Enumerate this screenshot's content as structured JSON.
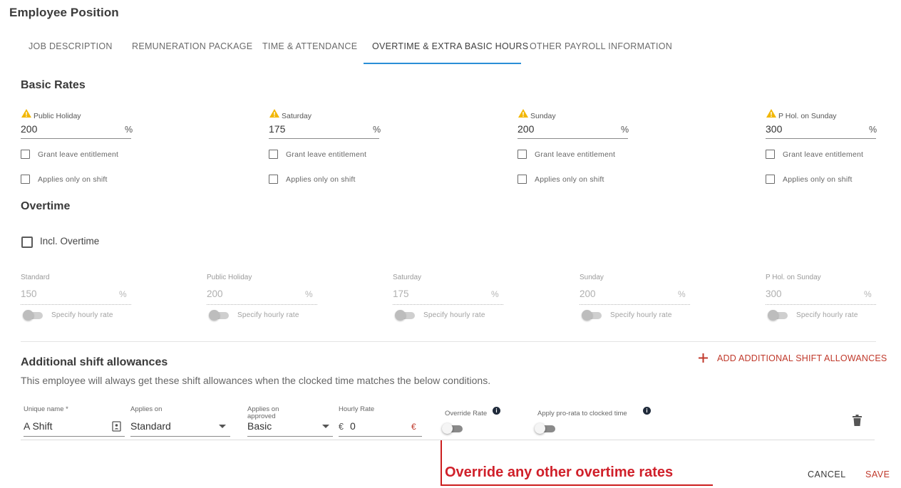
{
  "header": {
    "title": "Employee Position"
  },
  "tabs": [
    {
      "label": "JOB DESCRIPTION"
    },
    {
      "label": "REMUNERATION PACKAGE"
    },
    {
      "label": "TIME & ATTENDANCE"
    },
    {
      "label": "OVERTIME & EXTRA BASIC HOURS",
      "active": true
    },
    {
      "label": "OTHER PAYROLL INFORMATION"
    }
  ],
  "basic_rates": {
    "title": "Basic Rates",
    "fields": [
      {
        "label": "Public Holiday",
        "value": "200",
        "unit": "%",
        "grant_label": "Grant leave entitlement",
        "shift_label": "Applies only on shift",
        "grant_checked": false,
        "shift_checked": false
      },
      {
        "label": "Saturday",
        "value": "175",
        "unit": "%",
        "grant_label": "Grant leave entitlement",
        "shift_label": "Applies only on shift",
        "grant_checked": false,
        "shift_checked": false
      },
      {
        "label": "Sunday",
        "value": "200",
        "unit": "%",
        "grant_label": "Grant leave entitlement",
        "shift_label": "Applies only on shift",
        "grant_checked": false,
        "shift_checked": false
      },
      {
        "label": "P Hol. on Sunday",
        "value": "300",
        "unit": "%",
        "grant_label": "Grant leave entitlement",
        "shift_label": "Applies only on shift",
        "grant_checked": false,
        "shift_checked": false
      }
    ],
    "warning_icon": "warning-icon"
  },
  "overtime": {
    "title": "Overtime",
    "incl_label": "Incl. Overtime",
    "incl_checked": false,
    "fields": [
      {
        "label": "Standard",
        "value": "150",
        "unit": "%",
        "toggle_label": "Specify hourly rate"
      },
      {
        "label": "Public Holiday",
        "value": "200",
        "unit": "%",
        "toggle_label": "Specify hourly rate"
      },
      {
        "label": "Saturday",
        "value": "175",
        "unit": "%",
        "toggle_label": "Specify hourly rate"
      },
      {
        "label": "Sunday",
        "value": "200",
        "unit": "%",
        "toggle_label": "Specify hourly rate"
      },
      {
        "label": "P Hol. on Sunday",
        "value": "300",
        "unit": "%",
        "toggle_label": "Specify hourly rate"
      }
    ]
  },
  "allowances": {
    "title": "Additional shift allowances",
    "subtitle": "This employee will always get these shift allowances when the clocked time matches the below conditions.",
    "add_label": "ADD ADDITIONAL SHIFT ALLOWANCES",
    "row": {
      "name_label": "Unique name *",
      "name_value": "A Shift",
      "applies_on_label": "Applies on",
      "applies_on_value": "Standard",
      "applies_approved_label_1": "Applies on",
      "applies_approved_label_2": "approved",
      "applies_approved_value": "Basic",
      "hourly_rate_label": "Hourly Rate",
      "hourly_rate_currency": "€",
      "hourly_rate_value": "0",
      "hourly_rate_suffix": "€",
      "override_label": "Override Rate",
      "prorata_label": "Apply pro-rata to clocked time"
    }
  },
  "callout": {
    "text": "Override any other overtime rates",
    "color": "#d0202a"
  },
  "footer": {
    "cancel_label": "CANCEL",
    "save_label": "SAVE"
  },
  "colors": {
    "accent": "#2a8fd6",
    "danger": "#c0392b",
    "warning": "#f2b705"
  }
}
